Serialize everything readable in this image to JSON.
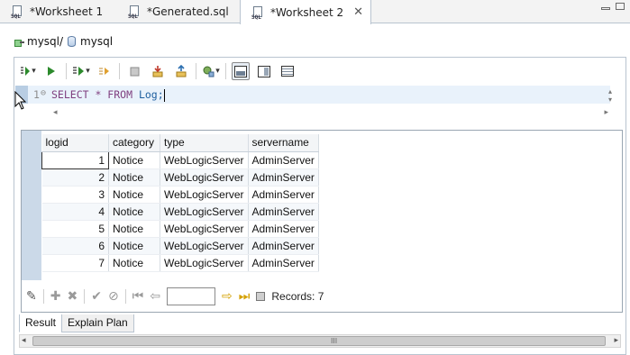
{
  "tabs": [
    {
      "label": "*Worksheet 1",
      "active": false
    },
    {
      "label": "*Generated.sql",
      "active": false
    },
    {
      "label": "*Worksheet 2",
      "active": true
    }
  ],
  "connection": {
    "path": "mysql/",
    "db": "mysql"
  },
  "toolbar": {
    "icons": [
      "run-dropdown-icon",
      "run-icon",
      "explain-dropdown-icon",
      "step-icon",
      "stop-icon",
      "import-icon",
      "export-icon",
      "format-dropdown-icon",
      "layout-horizontal-icon",
      "layout-vertical-icon",
      "layout-grid-icon"
    ]
  },
  "editor": {
    "line_number": "1",
    "fold_marker": "⊖",
    "sql_keywords": "SELECT * FROM ",
    "sql_ident": "Log;"
  },
  "results": {
    "columns": [
      "logid",
      "category",
      "type",
      "servername"
    ],
    "rows": [
      [
        "1",
        "Notice",
        "WebLogicServer",
        "AdminServer"
      ],
      [
        "2",
        "Notice",
        "WebLogicServer",
        "AdminServer"
      ],
      [
        "3",
        "Notice",
        "WebLogicServer",
        "AdminServer"
      ],
      [
        "4",
        "Notice",
        "WebLogicServer",
        "AdminServer"
      ],
      [
        "5",
        "Notice",
        "WebLogicServer",
        "AdminServer"
      ],
      [
        "6",
        "Notice",
        "WebLogicServer",
        "AdminServer"
      ],
      [
        "7",
        "Notice",
        "WebLogicServer",
        "AdminServer"
      ]
    ],
    "records_label": "Records: 7",
    "page_value": ""
  },
  "bottom_tabs": [
    "Result",
    "Explain Plan"
  ],
  "scroll": {
    "left_arrow": "◂",
    "right_arrow": "▸",
    "grip": "III"
  }
}
